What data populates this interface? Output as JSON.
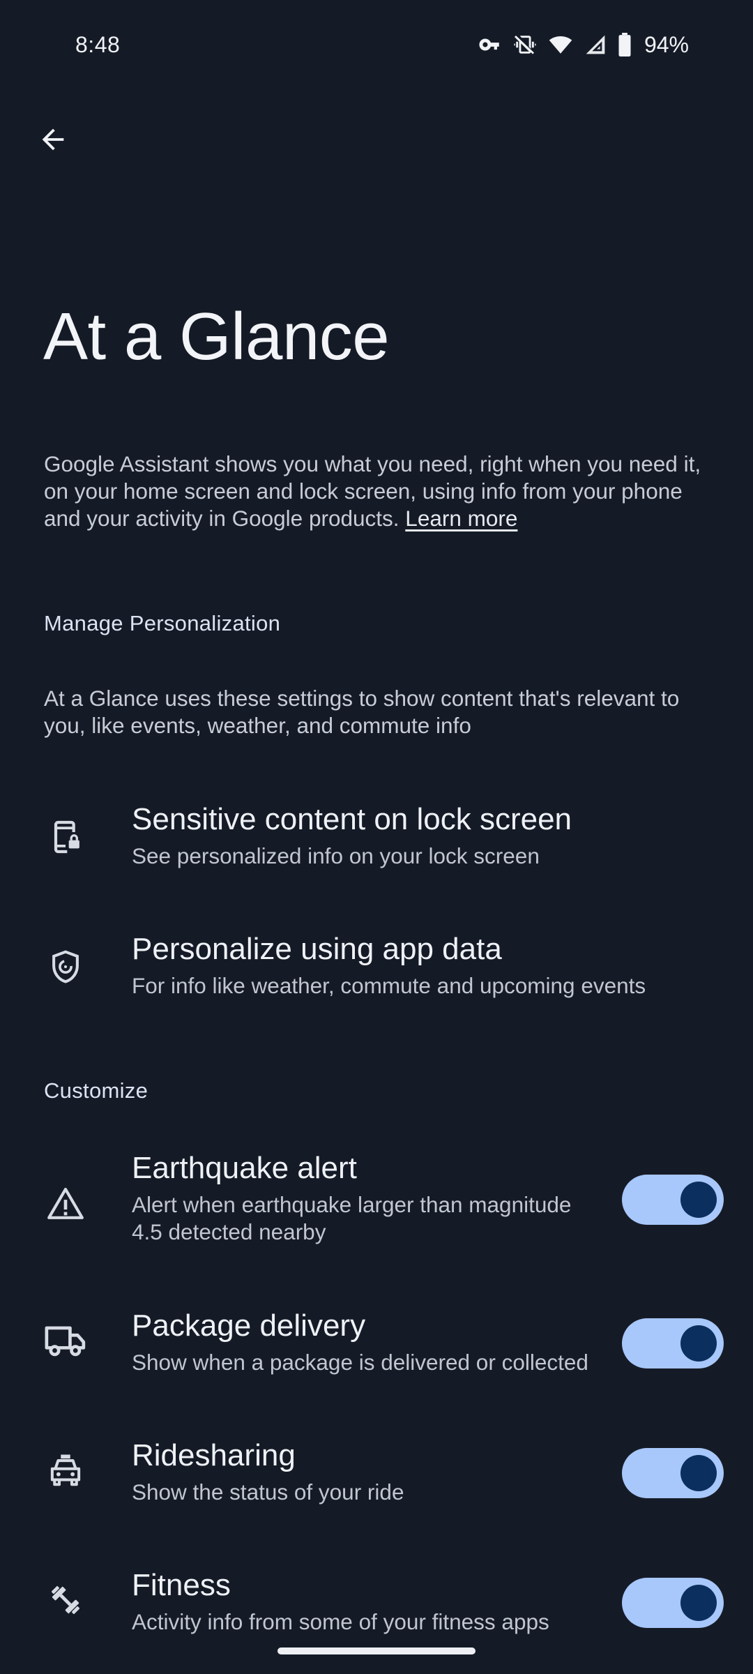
{
  "status_bar": {
    "time": "8:48",
    "battery_percent": "94%",
    "icons": [
      "vpn-key-icon",
      "vibrate-off-icon",
      "wifi-icon",
      "signal-icon",
      "battery-icon"
    ]
  },
  "header": {
    "back_icon": "arrow-back-icon",
    "title": "At a Glance"
  },
  "intro": {
    "text": "Google Assistant shows you what you need, right when you need it, on your home screen and lock screen, using info from your phone and your activity in Google products.",
    "learn_more": "Learn more"
  },
  "manage_section": {
    "header": "Manage Personalization",
    "description": "At a Glance uses these settings to show content that's relevant to you, like events, weather, and commute info",
    "items": [
      {
        "icon": "phone-lock-icon",
        "title": "Sensitive content on lock screen",
        "summary": "See personalized info on your lock screen"
      },
      {
        "icon": "shield-icon",
        "title": "Personalize using app data",
        "summary": "For info like weather, commute and upcoming events"
      }
    ]
  },
  "customize_section": {
    "header": "Customize",
    "items": [
      {
        "icon": "warning-triangle-icon",
        "title": "Earthquake alert",
        "summary": "Alert when earthquake larger than magnitude 4.5 detected nearby",
        "enabled": true
      },
      {
        "icon": "truck-icon",
        "title": "Package delivery",
        "summary": "Show when a package is delivered or collected",
        "enabled": true
      },
      {
        "icon": "car-icon",
        "title": "Ridesharing",
        "summary": "Show the status of your ride",
        "enabled": true
      },
      {
        "icon": "fitness-dumbbell-icon",
        "title": "Fitness",
        "summary": "Activity info from some of your fitness apps",
        "enabled": true
      }
    ]
  },
  "colors": {
    "background": "#151b26",
    "toggle_track_on": "#a8c7fa",
    "toggle_thumb_on": "#0b2f5e",
    "section_header": "#dce3f3"
  }
}
